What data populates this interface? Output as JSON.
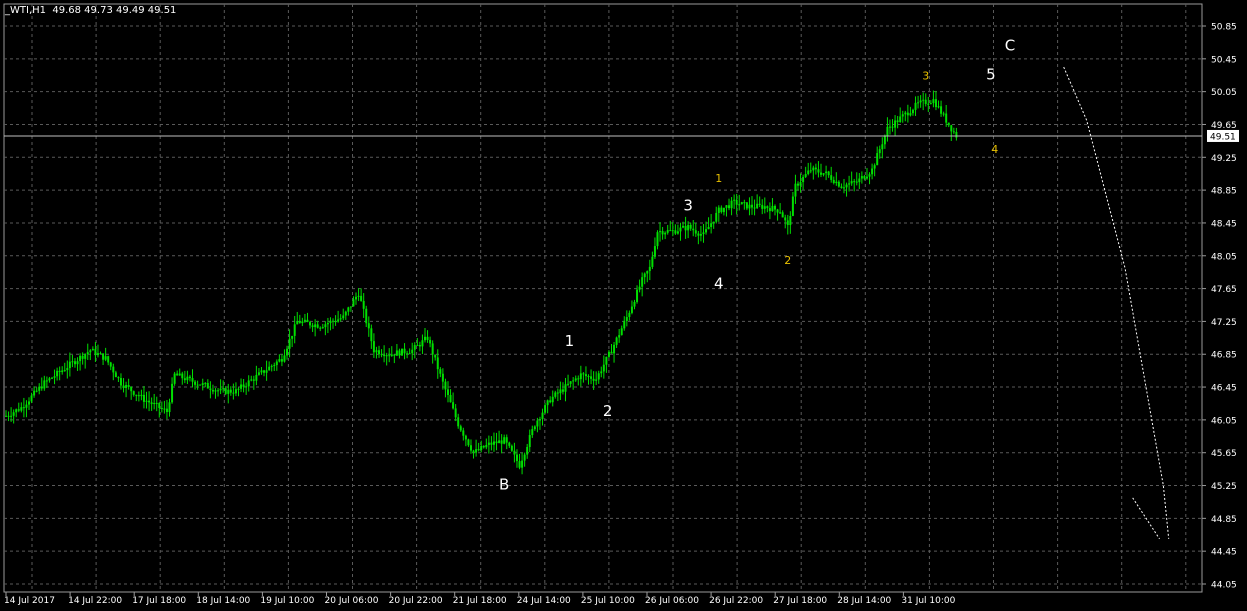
{
  "header": {
    "symbol": "_WTI,H1",
    "ohlc": "49.68 49.73 49.49 49.51"
  },
  "colors": {
    "background": "#000000",
    "grid": "#5a5a5a",
    "candle": "#00e000",
    "price_line": "#bfbfbf",
    "axis_text": "#ffffff",
    "label_white": "#ffffff",
    "label_yellow": "#e8c000",
    "projection": "#ffffff"
  },
  "chart_data": {
    "type": "candlestick",
    "title": "",
    "xlabel": "",
    "ylabel": "",
    "ylim": [
      44.05,
      51.0
    ],
    "grid": true,
    "y_ticks": [
      "50.85",
      "50.45",
      "50.05",
      "49.65",
      "49.25",
      "48.85",
      "48.45",
      "48.05",
      "47.65",
      "47.25",
      "46.85",
      "46.45",
      "46.05",
      "45.65",
      "45.25",
      "44.85",
      "44.45",
      "44.05"
    ],
    "x_ticks": [
      "14 Jul 2017",
      "14 Jul 22:00",
      "17 Jul 18:00",
      "18 Jul 14:00",
      "19 Jul 10:00",
      "20 Jul 06:00",
      "20 Jul 22:00",
      "21 Jul 18:00",
      "24 Jul 14:00",
      "25 Jul 10:00",
      "26 Jul 06:00",
      "26 Jul 22:00",
      "27 Jul 18:00",
      "28 Jul 14:00",
      "31 Jul 10:00"
    ],
    "current_price": "49.51",
    "price_path": [
      [
        0,
        46.1
      ],
      [
        2,
        46.2
      ],
      [
        5,
        46.5
      ],
      [
        8,
        46.7
      ],
      [
        11,
        46.9
      ],
      [
        13,
        46.8
      ],
      [
        15,
        46.5
      ],
      [
        18,
        46.3
      ],
      [
        21,
        46.15
      ],
      [
        22,
        46.6
      ],
      [
        25,
        46.5
      ],
      [
        28,
        46.4
      ],
      [
        30,
        46.4
      ],
      [
        33,
        46.6
      ],
      [
        36,
        46.8
      ],
      [
        38,
        47.25
      ],
      [
        41,
        47.2
      ],
      [
        44,
        47.3
      ],
      [
        46,
        47.6
      ],
      [
        48,
        46.9
      ],
      [
        50,
        46.85
      ],
      [
        53,
        46.9
      ],
      [
        55,
        47.05
      ],
      [
        57,
        46.5
      ],
      [
        59,
        46.0
      ],
      [
        61,
        45.65
      ],
      [
        63,
        45.75
      ],
      [
        65,
        45.8
      ],
      [
        67,
        45.5
      ],
      [
        69,
        46.0
      ],
      [
        71,
        46.3
      ],
      [
        73,
        46.45
      ],
      [
        75,
        46.6
      ],
      [
        77,
        46.55
      ],
      [
        79,
        46.9
      ],
      [
        81,
        47.3
      ],
      [
        83,
        47.75
      ],
      [
        84,
        47.9
      ],
      [
        85,
        48.35
      ],
      [
        87,
        48.35
      ],
      [
        89,
        48.4
      ],
      [
        91,
        48.3
      ],
      [
        93,
        48.6
      ],
      [
        95,
        48.7
      ],
      [
        97,
        48.65
      ],
      [
        99,
        48.65
      ],
      [
        101,
        48.6
      ],
      [
        102,
        48.4
      ],
      [
        103,
        48.9
      ],
      [
        105,
        49.1
      ],
      [
        107,
        49.05
      ],
      [
        109,
        48.9
      ],
      [
        111,
        48.95
      ],
      [
        113,
        49.1
      ],
      [
        115,
        49.6
      ],
      [
        117,
        49.75
      ],
      [
        119,
        49.9
      ],
      [
        121,
        49.95
      ],
      [
        123,
        49.65
      ],
      [
        124,
        49.51
      ]
    ],
    "wave_labels": [
      {
        "text": "B",
        "x": 65,
        "y": 45.2,
        "color": "white"
      },
      {
        "text": "1",
        "x": 73.5,
        "y": 46.95,
        "color": "white"
      },
      {
        "text": "2",
        "x": 78.5,
        "y": 46.1,
        "color": "white"
      },
      {
        "text": "3",
        "x": 89,
        "y": 48.6,
        "color": "white"
      },
      {
        "text": "4",
        "x": 93,
        "y": 47.65,
        "color": "white"
      },
      {
        "text": "1",
        "x": 93,
        "y": 48.95,
        "color": "yellow"
      },
      {
        "text": "2",
        "x": 102,
        "y": 47.95,
        "color": "yellow"
      },
      {
        "text": "3",
        "x": 120,
        "y": 50.2,
        "color": "yellow"
      },
      {
        "text": "4",
        "x": 129,
        "y": 49.3,
        "color": "yellow"
      },
      {
        "text": "5",
        "x": 128.5,
        "y": 50.2,
        "color": "white"
      },
      {
        "text": "C",
        "x": 131,
        "y": 50.55,
        "color": "white"
      }
    ],
    "projection_path": [
      [
        138,
        50.35
      ],
      [
        141,
        49.7
      ],
      [
        146,
        47.9
      ],
      [
        151,
        45.25
      ],
      [
        151.7,
        44.6
      ]
    ],
    "projection_branch": [
      [
        147,
        45.1
      ],
      [
        150.5,
        44.6
      ]
    ]
  }
}
